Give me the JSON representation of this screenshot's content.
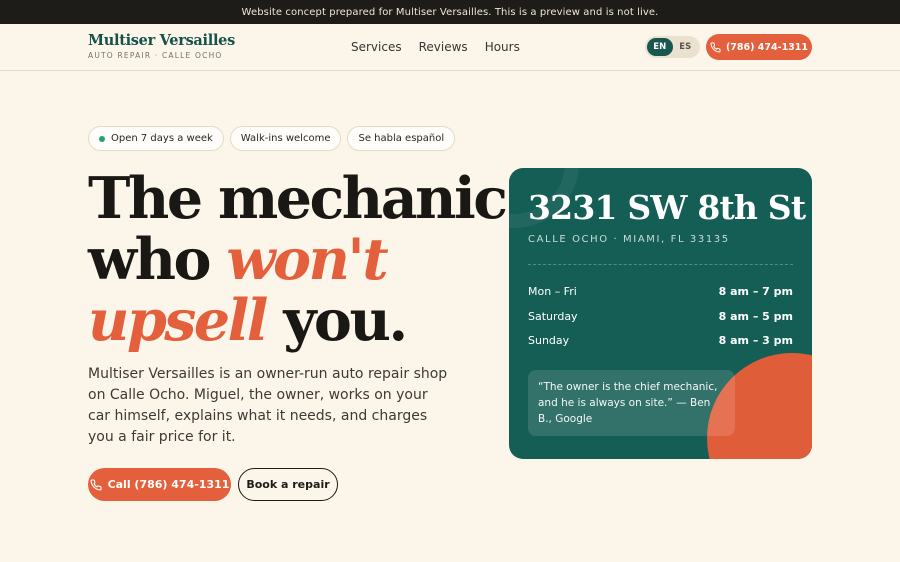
{
  "topbar": {
    "notice": "Website concept prepared for Multiser Versailles. This is a preview and is not live."
  },
  "brand": {
    "name": "Multiser Versailles",
    "tagline": "AUTO REPAIR · CALLE OCHO"
  },
  "nav": {
    "items": [
      "Services",
      "Reviews",
      "Hours"
    ]
  },
  "lang": {
    "en": "EN",
    "es": "ES",
    "active": "EN"
  },
  "header": {
    "call_label": "(786) 474-1311"
  },
  "hero": {
    "pills": [
      "Open 7 days a week",
      "Walk-ins welcome",
      "Se habla español"
    ],
    "headline_1": "The mechanic",
    "headline_2a": "who ",
    "headline_2b": "won't",
    "headline_3a": "upsell",
    "headline_3b": " you.",
    "lead": "Multiser Versailles is an owner-run auto repair shop on Calle Ocho. Miguel, the owner, works on your car himself, explains what it needs, and charges you a fair price for it.",
    "call_button": "Call (786) 474-1311",
    "book_button": "Book a repair"
  },
  "card": {
    "address": "3231 SW 8th St",
    "city": "CALLE OCHO · MIAMI, FL 33135",
    "hours": [
      {
        "day": "Mon – Fri",
        "time": "8 am – 7 pm"
      },
      {
        "day": "Saturday",
        "time": "8 am – 5 pm"
      },
      {
        "day": "Sunday",
        "time": "8 am – 3 pm"
      }
    ],
    "quote": "“The owner is the chief mechanic, and he is always on site.” — Ben B., Google"
  },
  "colors": {
    "accent": "#e4603d",
    "brand_green": "#155e56",
    "background": "#fbf5ea",
    "open_dot": "#27a079"
  },
  "icons": {
    "phone": "phone-icon",
    "status": "green-dot-icon"
  }
}
